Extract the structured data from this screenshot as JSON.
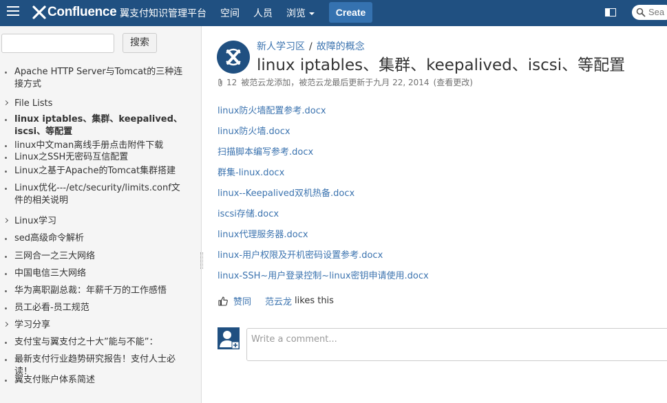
{
  "header": {
    "logo_text": "Confluence",
    "site_title": "翼支付知识管理平台",
    "nav": [
      {
        "label": "空间"
      },
      {
        "label": "人员"
      },
      {
        "label": "浏览"
      }
    ],
    "create_label": "Create",
    "search_placeholder": "Sea",
    "colors": {
      "bar": "#205081",
      "create": "#3572b0"
    }
  },
  "sidebar": {
    "search_button": "搜索",
    "search_value": "",
    "items": [
      {
        "label": "Apache HTTP Server与Tomcat的三种连接方式",
        "marker": "bullet"
      },
      {
        "label": "File Lists",
        "marker": "arrow"
      },
      {
        "label": "linux iptables、集群、keepalived、iscsi、等配置",
        "marker": "bullet",
        "current": true
      },
      {
        "label": "linux中文man离线手册点击附件下载",
        "marker": "bullet"
      },
      {
        "label": "Linux之SSH无密码互信配置",
        "marker": "bullet"
      },
      {
        "label": "Linux之基于Apache的Tomcat集群搭建",
        "marker": "bullet"
      },
      {
        "label": "Linux优化---/etc/security/limits.conf文件的相关说明",
        "marker": "bullet"
      },
      {
        "label": "Linux学习",
        "marker": "arrow"
      },
      {
        "label": "sed高级命令解析",
        "marker": "bullet"
      },
      {
        "label": "三网合一之三大网络",
        "marker": "bullet"
      },
      {
        "label": "中国电信三大网络",
        "marker": "bullet"
      },
      {
        "label": "华为离职副总裁：年薪千万的工作感悟",
        "marker": "bullet"
      },
      {
        "label": "员工必看-员工规范",
        "marker": "bullet"
      },
      {
        "label": "学习分享",
        "marker": "arrow"
      },
      {
        "label": "支付宝与翼支付之十大”能与不能”：",
        "marker": "bullet"
      },
      {
        "label": "最新支付行业趋势研究报告！支付人士必读！",
        "marker": "bullet"
      },
      {
        "label": "翼支付账户体系简述",
        "marker": "bullet"
      }
    ]
  },
  "page": {
    "breadcrumb": [
      "新人学习区",
      "故障的概念"
    ],
    "title": "linux iptables、集群、keepalived、iscsi、等配置",
    "meta": {
      "attachment_count": "12",
      "created_by": "被范云龙添加，被范云龙最后更新于九月 22, 2014",
      "view_changes": "(查看更改)"
    },
    "attachments": [
      "linux防火墙配置参考.docx",
      "linux防火墙.docx",
      "扫描脚本编写参考.docx",
      "群集-linux.docx",
      "linux--Keepalived双机热备.docx",
      "iscsi存储.docx",
      "linux代理服务器.docx",
      "linux-用户权限及开机密码设置参考.docx",
      "linux-SSH~用户登录控制~linux密钥申请使用.docx"
    ],
    "like": {
      "button": "赞同",
      "liker": "范云龙",
      "suffix": "likes this"
    },
    "comment_placeholder": "Write a comment..."
  }
}
